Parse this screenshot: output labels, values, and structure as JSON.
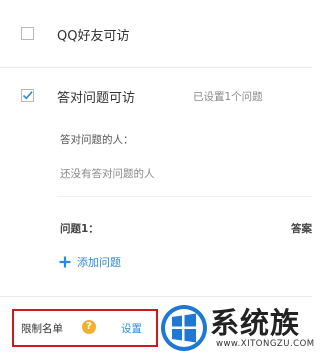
{
  "options": {
    "qq_friends": {
      "label": "QQ好友可访",
      "checked": false
    },
    "answer_question": {
      "label": "答对问题可访",
      "checked": true,
      "status": "已设置1个问题"
    }
  },
  "answered_people": {
    "title": "答对问题的人：",
    "empty": "还没有答对问题的人"
  },
  "question": {
    "label": "问题1：",
    "answer_label_partial": "答案",
    "add_label": "添加问题"
  },
  "restriction": {
    "label": "限制名单",
    "help_glyph": "?",
    "settings_label": "设置"
  },
  "watermark": {
    "brand": "系统族",
    "url": "www.XITONGZU.COM"
  },
  "colors": {
    "accent": "#2d8cd8",
    "highlight_border": "#d0191c",
    "help_icon": "#f2b033"
  }
}
